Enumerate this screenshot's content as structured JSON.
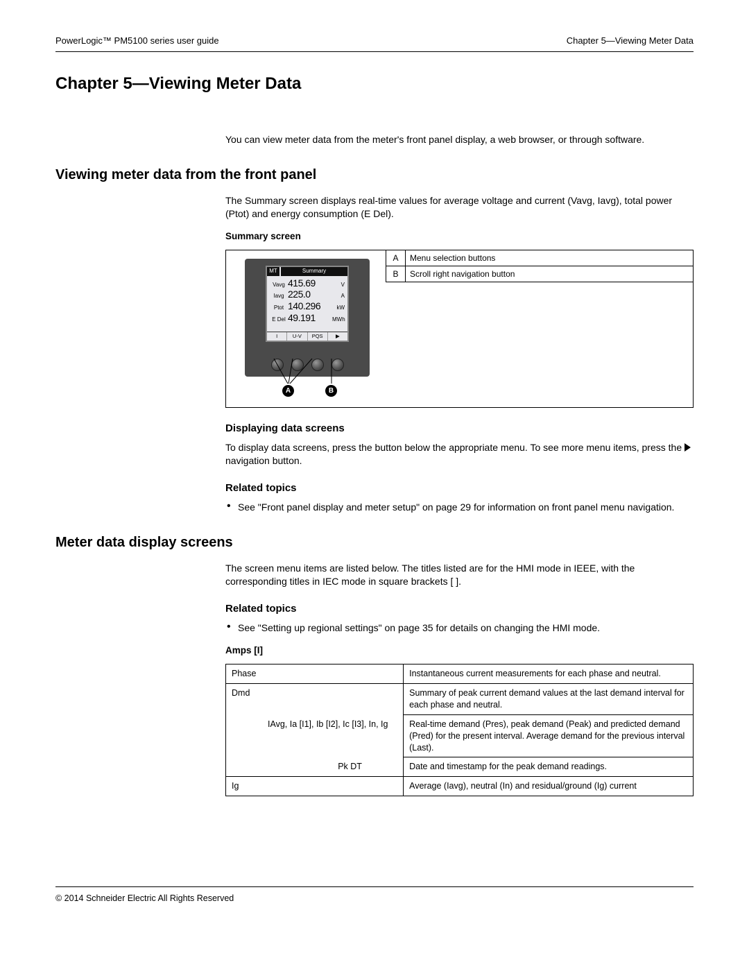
{
  "header": {
    "left": "PowerLogic™  PM5100 series user guide",
    "right": "Chapter 5—Viewing Meter Data"
  },
  "h1": "Chapter 5—Viewing Meter Data",
  "intro": "You can view meter data from the meter's front panel display, a web browser, or through software.",
  "sec_frontpanel": {
    "title": "Viewing meter data from the front panel",
    "para": "The Summary screen displays real-time values for average voltage and current (Vavg, Iavg), total power (Ptot) and energy consumption (E Del).",
    "caption": "Summary screen",
    "legend": {
      "A": "Menu selection buttons",
      "B": "Scroll right navigation button"
    },
    "meter": {
      "corner": "MT",
      "title": "Summary",
      "rows": [
        {
          "lbl": "Vavg",
          "val": "415.69",
          "unit": "V"
        },
        {
          "lbl": "Iavg",
          "val": "225.0",
          "unit": "A"
        },
        {
          "lbl": "Ptot",
          "val": "140.296",
          "unit": "kW"
        },
        {
          "lbl": "E Del",
          "val": "49.191",
          "unit": "MWh"
        }
      ],
      "menu": [
        "I",
        "U-V",
        "PQS",
        "▶"
      ]
    },
    "h_display": "Displaying data screens",
    "p_display_1": "To display data screens, press the button below the appropriate menu. To see more menu items, press the ",
    "p_display_2": " navigation button.",
    "h_related": "Related topics",
    "rel1": "See \"Front panel display and meter setup\" on page 29 for information on front panel menu navigation."
  },
  "sec_screens": {
    "title": "Meter data display screens",
    "para": "The screen menu items are listed below. The titles listed are for the HMI mode in IEEE, with the corresponding titles in IEC mode in square brackets [ ].",
    "h_related": "Related topics",
    "rel1": "See \"Setting up regional settings\" on page 35 for details on changing the HMI mode.",
    "table_caption": "Amps [I]",
    "rows": [
      {
        "c1": "Phase",
        "c2": "Instantaneous current measurements for each phase and neutral."
      },
      {
        "c1": "Dmd",
        "c2": "Summary of peak current demand values at the last demand interval for each phase and neutral."
      },
      {
        "c1": "IAvg, Ia [I1], Ib [I2], Ic [I3], In, Ig",
        "c2": "Real-time demand (Pres), peak demand (Peak) and predicted demand (Pred) for the present interval. Average demand for the previous interval (Last).",
        "indent": 1
      },
      {
        "c1": "Pk DT",
        "c2": "Date and timestamp for the peak demand readings.",
        "indent": 2
      },
      {
        "c1": "Ig",
        "c2": "Average (Iavg), neutral (In) and residual/ground (Ig) current"
      }
    ]
  },
  "footer": "© 2014 Schneider Electric All Rights Reserved"
}
